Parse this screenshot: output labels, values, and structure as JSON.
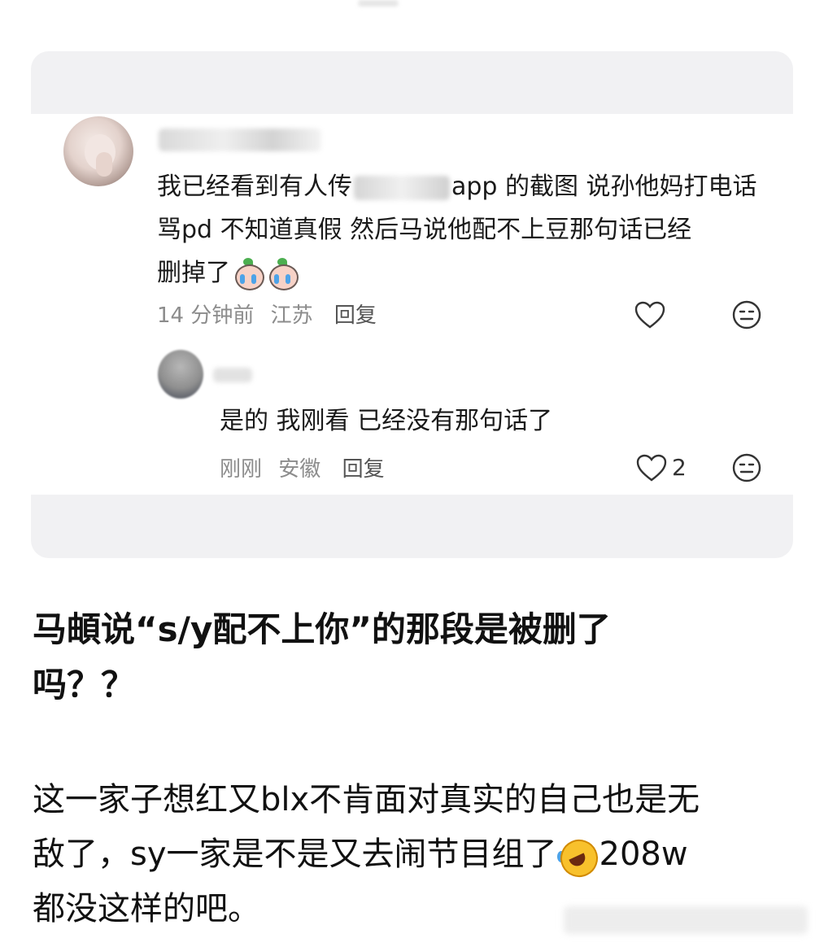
{
  "comment": {
    "text_line1_a": "我已经看到有人传",
    "text_line1_b": "app 的截图 说孙他妈打电话",
    "text_line2": "骂pd  不知道真假 然后马说他配不上豆那句话已经",
    "text_line3": "删掉了",
    "time": "14 分钟前",
    "location": "江苏",
    "reply_label": "回复",
    "icons": [
      "heart-icon",
      "emoji-icon",
      "crying-emoji-icon"
    ]
  },
  "reply": {
    "text": "是的  我刚看  已经没有那句话了",
    "time": "刚刚",
    "location": "安徽",
    "reply_label": "回复",
    "like_count": "2"
  },
  "headline": {
    "line1": "马頔说“s/y配不上你”的那段是被删了",
    "line2": "吗？？"
  },
  "body": {
    "line1": "这一家子想红又blx不肯面对真实的自己也是无",
    "line2a": "敌了，sy一家是不是又去闹节目组了",
    "line2b": "208w",
    "line3": "都没这样的吧。",
    "emoji": "rofl-emoji"
  }
}
